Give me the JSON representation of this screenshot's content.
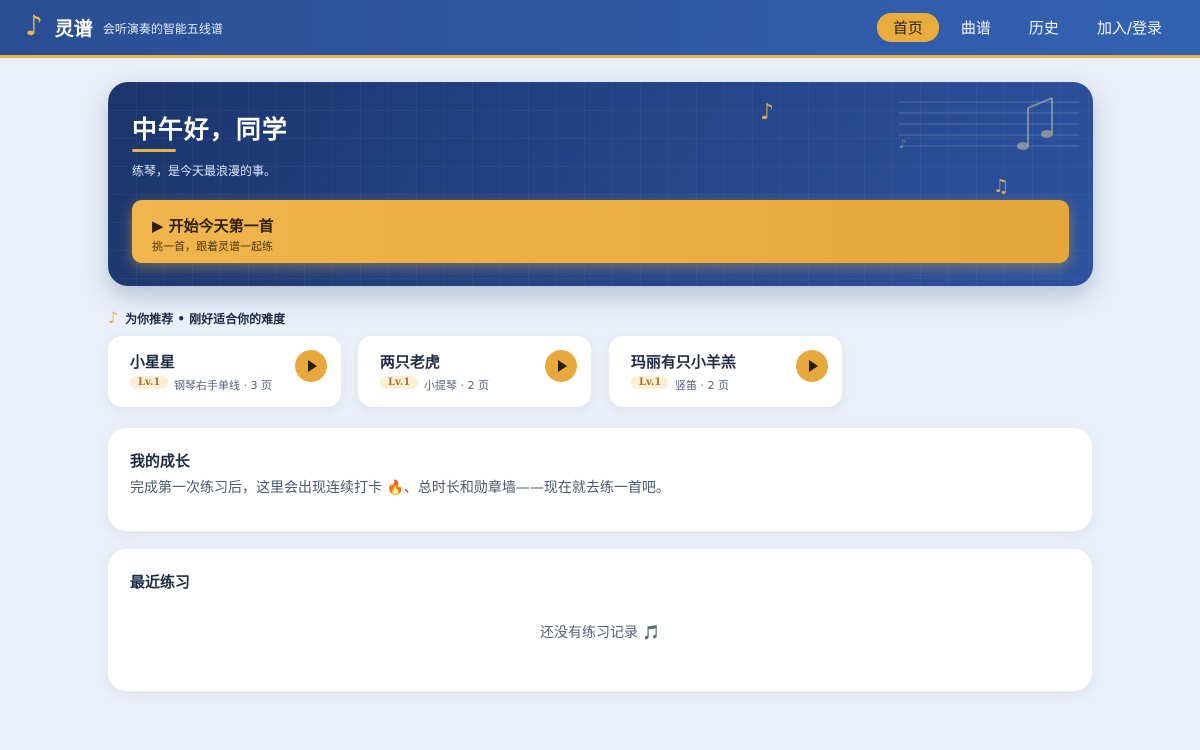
{
  "brand": {
    "icon": "music-note-icon",
    "name": "灵谱",
    "tagline": "会听演奏的智能五线谱"
  },
  "nav": {
    "items": [
      {
        "label": "首页",
        "active": true
      },
      {
        "label": "曲谱",
        "active": false
      },
      {
        "label": "历史",
        "active": false
      },
      {
        "label": "加入/登录",
        "active": false
      }
    ]
  },
  "hero": {
    "greeting": "中午好，同学",
    "subtitle": "练琴，是今天最浪漫的事。",
    "cta": {
      "title": "▶ 开始今天第一首",
      "subtitle": "挑一首，跟着灵谱一起练"
    },
    "accent_color": "#e8b24a"
  },
  "recommend": {
    "icon": "music-note-icon",
    "heading": "为你推荐 • 刚好适合你的难度",
    "cards": [
      {
        "title": "小星星",
        "level": "Lv.1",
        "meta": "钢琴右手单线 · 3 页"
      },
      {
        "title": "两只老虎",
        "level": "Lv.1",
        "meta": "小提琴 · 2 页"
      },
      {
        "title": "玛丽有只小羊羔",
        "level": "Lv.1",
        "meta": "竖笛 · 2 页"
      }
    ]
  },
  "growth": {
    "title": "我的成长",
    "text_before": "完成第一次练习后，这里会出现连续打卡 ",
    "fire_emoji": "🔥",
    "text_after": "、总时长和勋章墙——现在就去练一首吧。"
  },
  "recent": {
    "title": "最近练习",
    "empty_text": "还没有练习记录 ",
    "empty_emoji": "🎵"
  }
}
